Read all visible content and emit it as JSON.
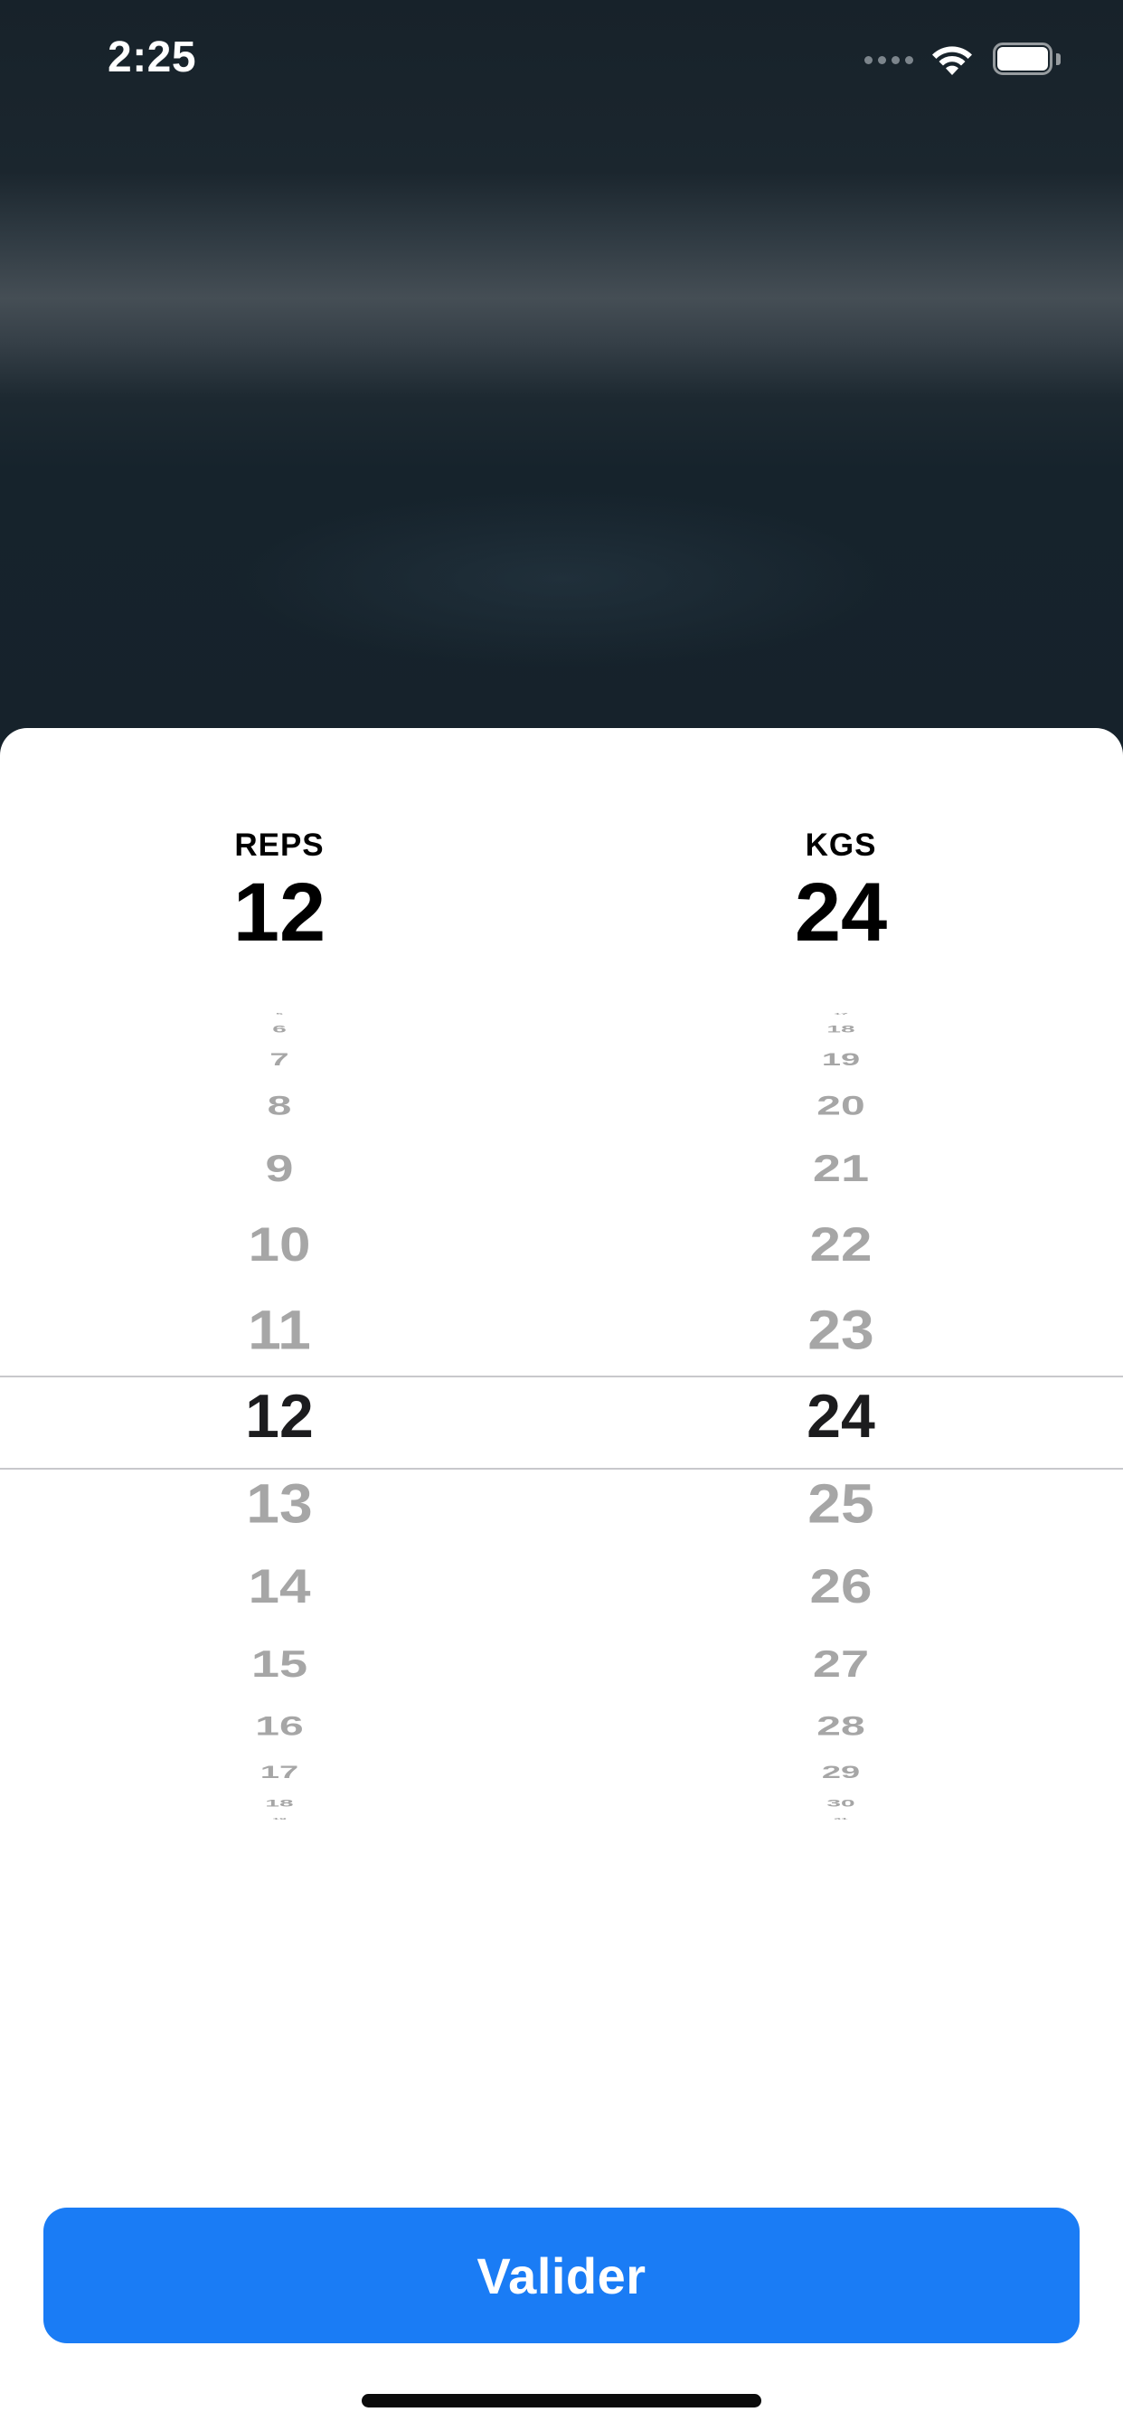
{
  "status_bar": {
    "time": "2:25",
    "icons": [
      "cellular-signal-icon",
      "wifi-icon",
      "battery-icon"
    ]
  },
  "picker": {
    "reps": {
      "label": "REPS",
      "value": "12",
      "rows": [
        "5",
        "6",
        "7",
        "8",
        "9",
        "10",
        "11",
        "12",
        "13",
        "14",
        "15",
        "16",
        "17",
        "18",
        "19"
      ]
    },
    "kgs": {
      "label": "KGS",
      "value": "24",
      "rows": [
        "17",
        "18",
        "19",
        "20",
        "21",
        "22",
        "23",
        "24",
        "25",
        "26",
        "27",
        "28",
        "29",
        "30",
        "31"
      ]
    },
    "selected_index": 7
  },
  "actions": {
    "validate_label": "Valider"
  },
  "colors": {
    "accent": "#1a7cf5",
    "background": "#16222b",
    "sheet": "#ffffff",
    "wheel_text": "#a6a6a6",
    "wheel_selected_text": "#1c1c1e"
  }
}
